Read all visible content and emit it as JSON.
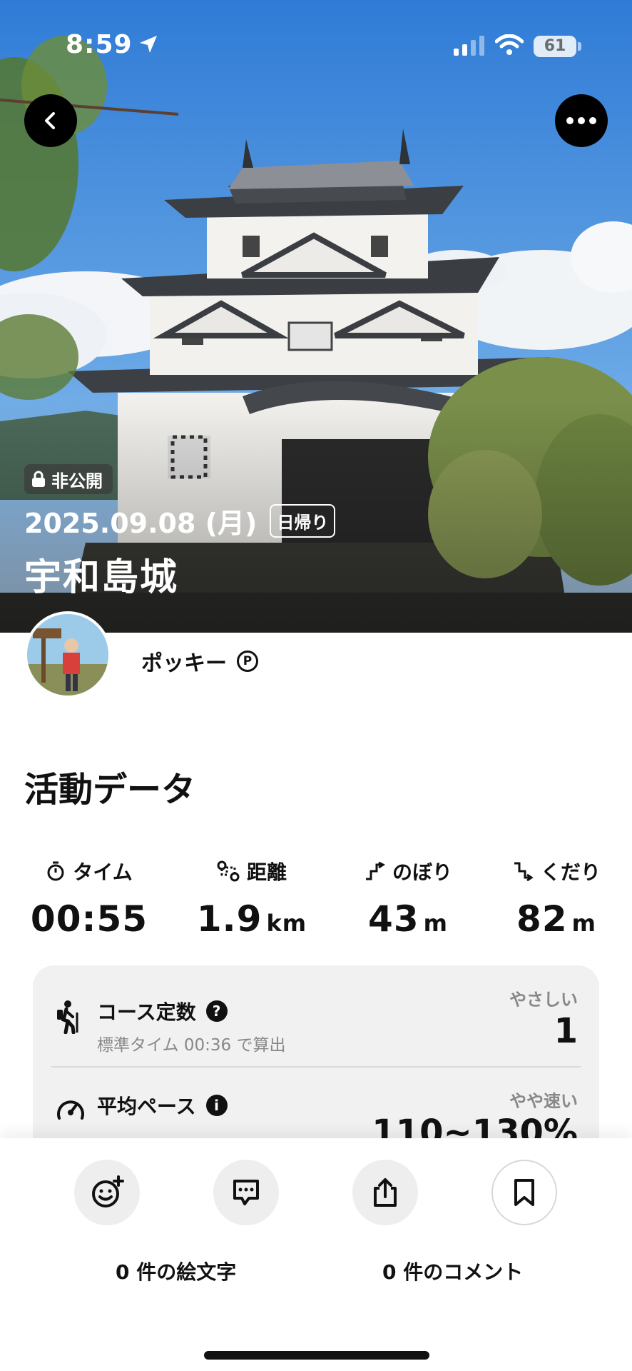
{
  "status_bar": {
    "time": "8:59",
    "battery": "61"
  },
  "hero": {
    "privacy_label": "非公開",
    "date": "2025.09.08 (月)",
    "trip_type": "日帰り",
    "title": "宇和島城"
  },
  "profile": {
    "username": "ポッキー",
    "badge": "P"
  },
  "activity": {
    "section_title": "活動データ",
    "stats": [
      {
        "label": "タイム",
        "value": "00:55",
        "unit": ""
      },
      {
        "label": "距離",
        "value": "1.9",
        "unit": "km"
      },
      {
        "label": "のぼり",
        "value": "43",
        "unit": "m"
      },
      {
        "label": "くだり",
        "value": "82",
        "unit": "m"
      }
    ],
    "course": {
      "title": "コース定数",
      "help": "?",
      "subtitle": "標準タイム 00:36 で算出",
      "level": "やさしい",
      "value": "1"
    },
    "pace": {
      "title": "平均ペース",
      "info": "i",
      "level": "やや速い",
      "value": "110~130%"
    }
  },
  "bottom_bar": {
    "emoji_count": "0 件の絵文字",
    "comment_count": "0 件のコメント"
  },
  "colors": {
    "sky": "#3f86d9",
    "card_bg": "#f1f1f1",
    "text": "#111111",
    "muted": "#888888"
  }
}
